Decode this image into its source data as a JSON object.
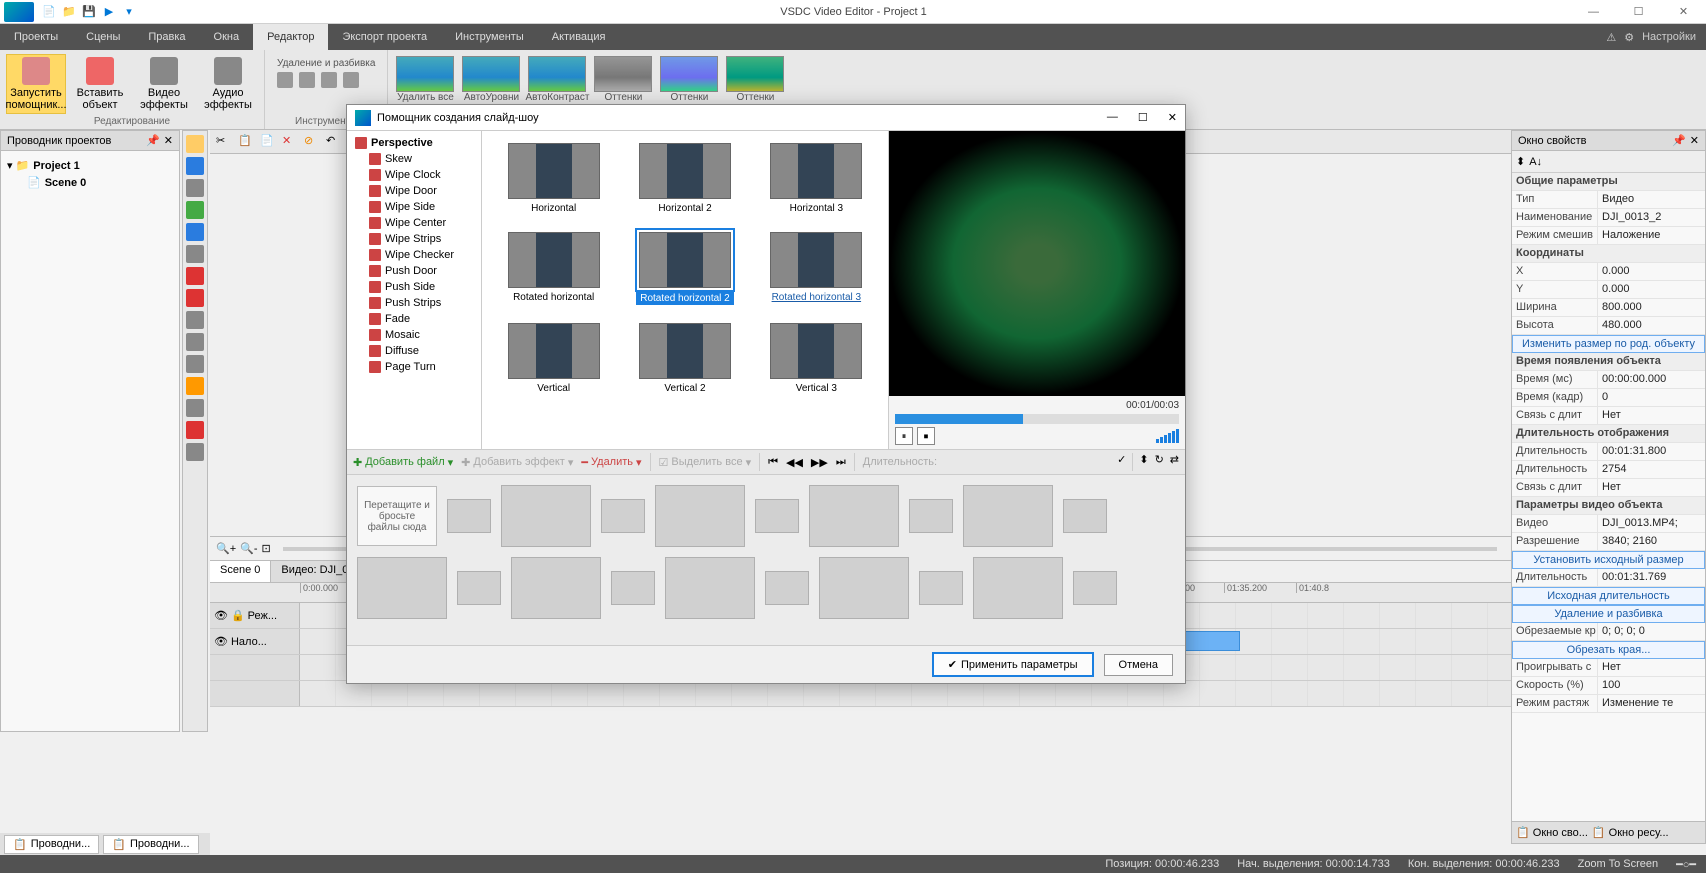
{
  "app": {
    "title": "VSDC Video Editor - Project 1"
  },
  "menu": {
    "items": [
      "Проекты",
      "Сцены",
      "Правка",
      "Окна",
      "Редактор",
      "Экспорт проекта",
      "Инструменты",
      "Активация"
    ],
    "active_index": 4,
    "settings": "Настройки"
  },
  "ribbon": {
    "group_edit": {
      "label": "Редактирование",
      "wizard": "Запустить помощник...",
      "insert": "Вставить объект",
      "video_fx": "Видео эффекты",
      "audio_fx": "Аудио эффекты"
    },
    "group_tools": {
      "label": "Инструменты",
      "del_split": "Удаление и разбивка"
    },
    "thumbs": [
      "Удалить все",
      "АвтоУровни",
      "АвтоКонтраст",
      "Оттенки",
      "Оттенки",
      "Оттенки"
    ]
  },
  "project_explorer": {
    "title": "Проводник проектов",
    "root": "Project 1",
    "scene": "Scene 0"
  },
  "properties": {
    "title": "Окно свойств",
    "sections": {
      "general": "Общие параметры",
      "coords": "Координаты",
      "appear": "Время появления объекта",
      "duration": "Длительность отображения",
      "videoobj": "Параметры видео объекта"
    },
    "rows": {
      "type_k": "Тип",
      "type_v": "Видео",
      "name_k": "Наименование",
      "name_v": "DJI_0013_2",
      "blend_k": "Режим смешив",
      "blend_v": "Наложение",
      "x_k": "X",
      "x_v": "0.000",
      "y_k": "Y",
      "y_v": "0.000",
      "w_k": "Ширина",
      "w_v": "800.000",
      "h_k": "Высота",
      "h_v": "480.000",
      "resize_btn": "Изменить размер по род. объекту",
      "time_ms_k": "Время (мс)",
      "time_ms_v": "00:00:00.000",
      "time_fr_k": "Время (кадр)",
      "time_fr_v": "0",
      "link1_k": "Связь с длит",
      "link1_v": "Нет",
      "dur1_k": "Длительность",
      "dur1_v": "00:01:31.800",
      "dur2_k": "Длительность",
      "dur2_v": "2754",
      "link2_k": "Связь с длит",
      "link2_v": "Нет",
      "video_k": "Видео",
      "video_v": "DJI_0013.MP4;",
      "res_k": "Разрешение",
      "res_v": "3840; 2160",
      "btn_origsize": "Установить исходный размер",
      "dur3_k": "Длительность",
      "dur3_v": "00:01:31.769",
      "btn_origdur": "Исходная длительность",
      "btn_delsplit": "Удаление и разбивка",
      "crop_k": "Обрезаемые кр",
      "crop_v": "0; 0; 0; 0",
      "btn_crop": "Обрезать края...",
      "play_k": "Проигрывать с",
      "play_v": "Нет",
      "speed_k": "Скорость (%)",
      "speed_v": "100",
      "stretch_k": "Режим растяж",
      "stretch_v": "Изменение те"
    },
    "tabs": {
      "t1": "Окно сво...",
      "t2": "Окно ресу..."
    }
  },
  "timeline": {
    "scene_tab": "Scene 0",
    "video_tab": "Видео: DJI_0...",
    "marks": [
      "0:00.000",
      "01:29.600",
      "01:35.200",
      "01:40.8"
    ],
    "track1": "Реж...",
    "track2": "Нало..."
  },
  "bottom_tabs": {
    "t1": "Проводни...",
    "t2": "Проводни..."
  },
  "statusbar": {
    "pos_k": "Позиция:",
    "pos_v": "00:00:46.233",
    "sel_start_k": "Нач. выделения:",
    "sel_start_v": "00:00:14.733",
    "sel_end_k": "Кон. выделения:",
    "sel_end_v": "00:00:46.233",
    "zoom": "Zoom To Screen"
  },
  "dialog": {
    "title": "Помощник создания слайд-шоу",
    "category": "Perspective",
    "items": [
      "Skew",
      "Wipe Clock",
      "Wipe Door",
      "Wipe Side",
      "Wipe Center",
      "Wipe Strips",
      "Wipe Checker",
      "Push Door",
      "Push Side",
      "Push Strips",
      "Fade",
      "Mosaic",
      "Diffuse",
      "Page Turn"
    ],
    "grid": [
      "Horizontal",
      "Horizontal 2",
      "Horizontal 3",
      "Rotated horizontal",
      "Rotated horizontal 2",
      "Rotated horizontal 3",
      "Vertical",
      "Vertical 2",
      "Vertical 3"
    ],
    "selected_index": 4,
    "link_index": 5,
    "preview_time": "00:01/00:03",
    "toolbar": {
      "add_file": "Добавить файл",
      "add_fx": "Добавить эффект",
      "delete": "Удалить",
      "select_all": "Выделить все",
      "duration": "Длительность:"
    },
    "drop_hint": "Перетащите и бросьте файлы сюда",
    "apply": "Применить параметры",
    "cancel": "Отмена"
  }
}
